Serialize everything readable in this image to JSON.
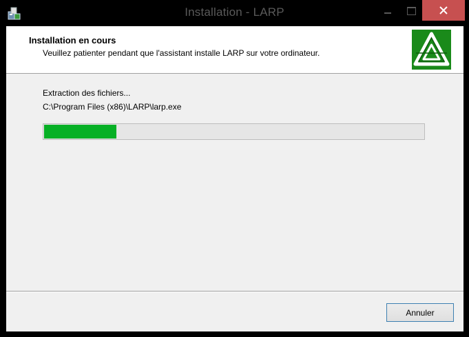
{
  "window": {
    "title": "Installation - LARP",
    "app_icon": "installer-icon",
    "controls": {
      "minimize_icon": "minimize-icon",
      "maximize_icon": "maximize-icon",
      "close_icon": "close-icon",
      "close_color": "#c75050"
    }
  },
  "header": {
    "title": "Installation en cours",
    "subtitle": "Veuillez patienter pendant que l'assistant installe LARP sur votre ordinateur.",
    "logo_icon": "larp-logo",
    "logo_color": "#1a8a1a"
  },
  "main": {
    "status": "Extraction des fichiers...",
    "current_file": "C:\\Program Files (x86)\\LARP\\larp.exe",
    "progress_fraction": 0.19,
    "progress_color": "#06b025"
  },
  "footer": {
    "cancel_label": "Annuler"
  }
}
